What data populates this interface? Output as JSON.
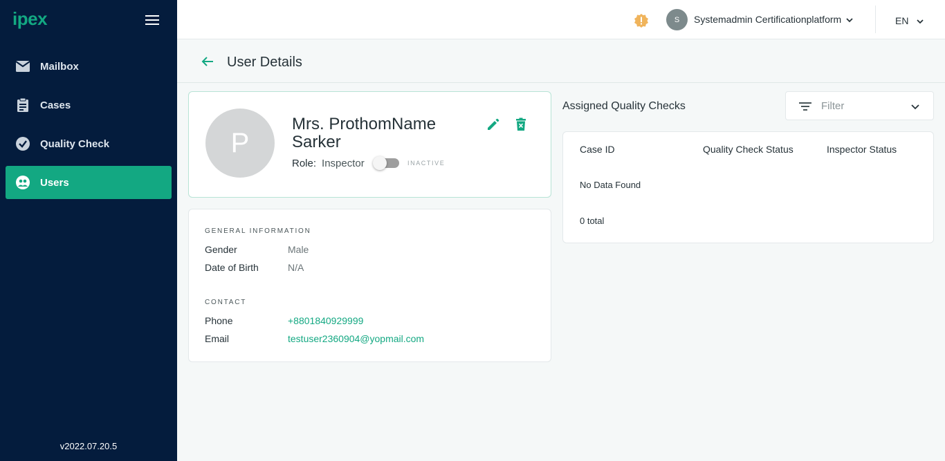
{
  "app": {
    "logo": "ipex",
    "version": "v2022.07.20.5"
  },
  "sidebar": {
    "items": [
      {
        "label": "Mailbox",
        "icon": "mail-icon",
        "active": false
      },
      {
        "label": "Cases",
        "icon": "clipboard-icon",
        "active": false
      },
      {
        "label": "Quality Check",
        "icon": "check-circle-icon",
        "active": false
      },
      {
        "label": "Users",
        "icon": "users-icon",
        "active": true
      }
    ]
  },
  "topbar": {
    "avatar_initial": "S",
    "user_name": "Systemadmin Certificationplatform",
    "language": "EN",
    "warning_color": "#f0b45c"
  },
  "page": {
    "title": "User Details"
  },
  "profile": {
    "avatar_initial": "P",
    "name": "Mrs. ProthomName Sarker",
    "role_label": "Role:",
    "role_value": "Inspector",
    "status": "INACTIVE"
  },
  "general": {
    "section_title": "GENERAL INFORMATION",
    "gender_label": "Gender",
    "gender_value": "Male",
    "dob_label": "Date of Birth",
    "dob_value": "N/A"
  },
  "contact": {
    "section_title": "CONTACT",
    "phone_label": "Phone",
    "phone_value": "+8801840929999",
    "email_label": "Email",
    "email_value": "testuser2360904@yopmail.com"
  },
  "assigned": {
    "title": "Assigned Quality Checks",
    "filter_placeholder": "Filter",
    "columns": [
      "Case ID",
      "Quality Check Status",
      "Inspector Status"
    ],
    "empty_text": "No Data Found",
    "total_text": "0 total"
  },
  "colors": {
    "accent": "#13a882",
    "sidebar_bg": "#041c3d"
  }
}
